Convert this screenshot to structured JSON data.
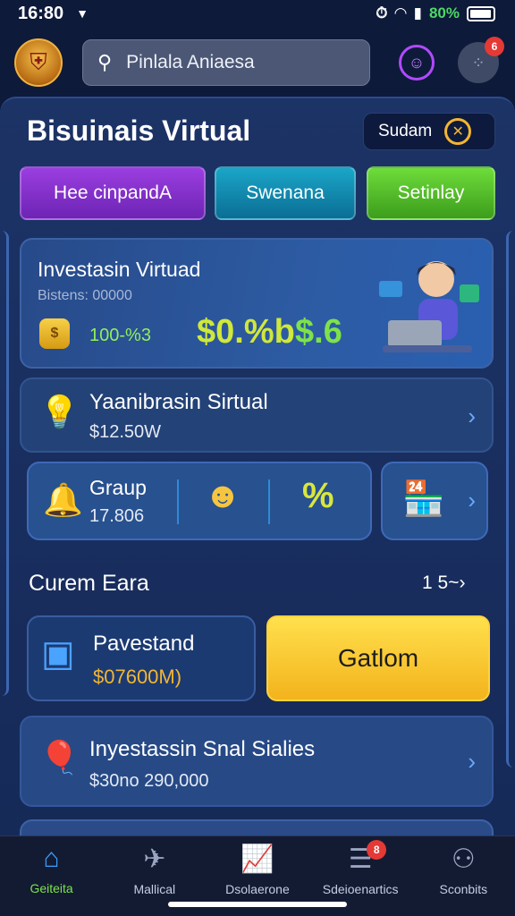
{
  "status_bar": {
    "time": "16:80",
    "battery_percent": "80%"
  },
  "header": {
    "search_text": "Pinlala Aniaesa",
    "menu_badge": "6"
  },
  "page": {
    "title": "Bisuinais Virtual",
    "select_label": "Sudam"
  },
  "tabs": [
    {
      "label": "Hee cinpandA"
    },
    {
      "label": "Swenana"
    },
    {
      "label": "Setinlay"
    }
  ],
  "hero": {
    "title": "Investasin Virtuad",
    "subtitle": "Bistens: 00000",
    "percent": "100-%3",
    "big_value_1": "$0.%b",
    "big_value_2": "$.6"
  },
  "rows": {
    "row1": {
      "title": "Yaanibrasin Sirtual",
      "value": "$12.50W"
    },
    "group": {
      "title": "Graup",
      "value": "17.806",
      "extra": "%"
    },
    "invest_stand": {
      "title": "Pavestand",
      "value": "$07600M)"
    },
    "row2": {
      "title": "Inyestassin Snal Sialies",
      "value": "$30no 290,000"
    }
  },
  "section": {
    "title": "Curem Eara",
    "pager": "1 5~"
  },
  "cta": {
    "label": "Gatlom"
  },
  "bottom_nav": [
    {
      "label": "Geiteita"
    },
    {
      "label": "Mallical"
    },
    {
      "label": "Dsolaerone"
    },
    {
      "label": "Sdeioenartics",
      "badge": "8"
    },
    {
      "label": "Sconbits"
    }
  ],
  "colors": {
    "accent_green": "#7ee24a",
    "accent_yellow": "#f3b31c",
    "nav_active": "#3ba1ff"
  }
}
